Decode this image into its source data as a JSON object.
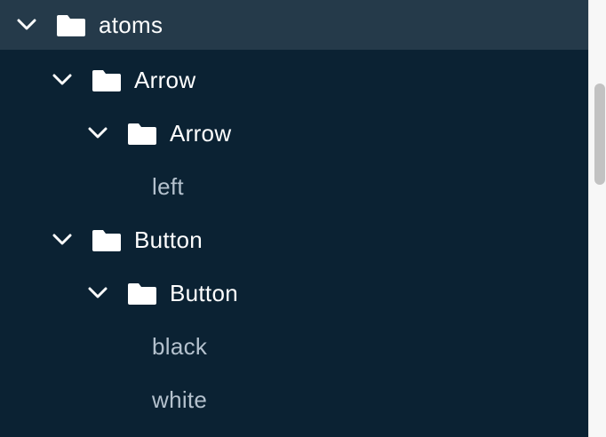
{
  "tree": {
    "root": {
      "label": "atoms",
      "expanded": true,
      "selected": true
    },
    "groups": [
      {
        "label": "Arrow",
        "child": {
          "label": "Arrow",
          "items": [
            "left"
          ]
        }
      },
      {
        "label": "Button",
        "child": {
          "label": "Button",
          "items": [
            "black",
            "white"
          ]
        }
      }
    ]
  },
  "icons": {
    "expand": "chevron-down-icon",
    "folder": "folder-icon"
  },
  "colors": {
    "background": "#0b2233",
    "selected_row": "#253a4a",
    "label": "#ffffff",
    "leaf_label": "#b4c1cd",
    "scrollbar_track": "#f7f7f7",
    "scrollbar_thumb": "#c2c2c2"
  }
}
